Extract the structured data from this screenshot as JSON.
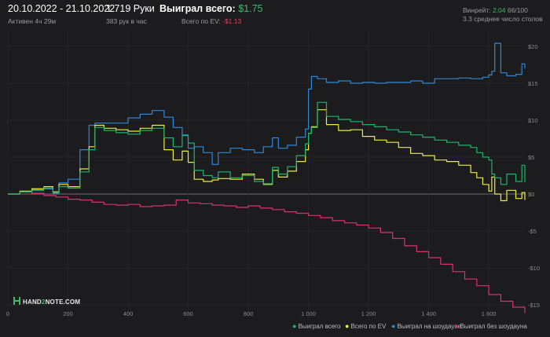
{
  "header": {
    "date_range": "20.10.2022 - 21.10.2022",
    "active": "Активен 4ч 29м",
    "hands": "1 719 Руки",
    "hands_per_hour": "383 рук в час",
    "won_total_label": "Выиграл всего:",
    "won_total_value": "$1.75",
    "ev_label": "Всего по EV:",
    "ev_value": "-$1.13",
    "winrate_label": "Винрейт:",
    "winrate_value": "2.04",
    "winrate_suffix": "66/100",
    "avg_table": "3.3 среднее число столов"
  },
  "logo": {
    "text_left": "HAND",
    "text_mid": "2",
    "text_right": "NOTE.COM"
  },
  "colors": {
    "won_total": "#1db46a",
    "ev": "#eded3a",
    "showdown": "#2f86d6",
    "non_showdown": "#d8336b",
    "background": "#1c1c1e",
    "grid": "#2c2c2e",
    "zero_line": "#8a8a8a"
  },
  "chart_data": {
    "type": "line",
    "xlim": [
      0,
      1720
    ],
    "ylim": [
      -17,
      22
    ],
    "x_ticks": [
      0,
      200,
      400,
      600,
      800,
      1000,
      1200,
      1400,
      1600
    ],
    "x_tick_labels": [
      "0",
      "200",
      "400",
      "600",
      "800",
      "1 000",
      "1 200",
      "1 400",
      "1 600"
    ],
    "y_ticks": [
      20,
      15,
      10,
      5,
      0,
      -5,
      -10,
      -15
    ],
    "y_tick_labels": [
      "$20",
      "$15",
      "$10",
      "$5",
      "$0",
      "-$5",
      "-$10",
      "-$15"
    ],
    "legend_position": "bottom-right",
    "series": [
      {
        "name": "Выиграл всего",
        "color_key": "won_total",
        "x": [
          0,
          40,
          80,
          120,
          150,
          170,
          200,
          240,
          270,
          290,
          320,
          360,
          400,
          440,
          480,
          520,
          550,
          580,
          600,
          620,
          650,
          680,
          700,
          740,
          780,
          820,
          850,
          880,
          900,
          930,
          960,
          990,
          1000,
          1010,
          1030,
          1060,
          1100,
          1140,
          1180,
          1220,
          1260,
          1300,
          1340,
          1380,
          1420,
          1460,
          1500,
          1540,
          1560,
          1580,
          1600,
          1610,
          1620,
          1640,
          1660,
          1690,
          1710,
          1720
        ],
        "y": [
          0,
          0.3,
          0.5,
          0.8,
          0.2,
          1.0,
          0.8,
          3.0,
          6.0,
          9.0,
          8.6,
          8.3,
          8.1,
          8.6,
          8.9,
          7.6,
          6.4,
          7.9,
          6.9,
          3.2,
          2.5,
          2.2,
          3.0,
          2.2,
          2.5,
          1.7,
          1.4,
          3.6,
          2.7,
          3.7,
          5.2,
          6.8,
          8.2,
          9.0,
          12.4,
          10.5,
          10.1,
          9.8,
          9.4,
          9.1,
          8.7,
          8.4,
          8.0,
          7.7,
          7.3,
          7.0,
          6.6,
          6.3,
          5.6,
          5.0,
          4.6,
          2.7,
          2.2,
          1.3,
          2.7,
          1.7,
          3.9,
          1.6
        ]
      },
      {
        "name": "Всего по EV",
        "color_key": "ev",
        "x": [
          0,
          40,
          80,
          120,
          150,
          170,
          200,
          240,
          270,
          290,
          320,
          360,
          400,
          440,
          480,
          520,
          550,
          580,
          600,
          620,
          650,
          680,
          700,
          740,
          780,
          820,
          850,
          880,
          900,
          930,
          960,
          990,
          1000,
          1010,
          1030,
          1060,
          1100,
          1140,
          1180,
          1220,
          1260,
          1300,
          1340,
          1380,
          1420,
          1460,
          1500,
          1540,
          1560,
          1580,
          1600,
          1610,
          1620,
          1640,
          1660,
          1690,
          1710,
          1720
        ],
        "y": [
          0,
          0.4,
          0.7,
          1.0,
          0.3,
          1.3,
          1.0,
          3.4,
          6.4,
          9.3,
          8.9,
          8.7,
          8.5,
          8.9,
          9.3,
          6.0,
          4.6,
          5.8,
          4.3,
          2.0,
          1.7,
          1.9,
          2.1,
          2.0,
          2.7,
          2.0,
          1.3,
          3.2,
          2.3,
          3.1,
          4.4,
          6.0,
          8.2,
          9.1,
          11.4,
          9.4,
          8.6,
          8.7,
          7.8,
          7.3,
          7.0,
          6.3,
          5.5,
          5.2,
          4.6,
          4.4,
          3.9,
          2.9,
          2.2,
          1.3,
          0.4,
          2.3,
          0.0,
          -0.9,
          0.5,
          -0.6,
          0.2,
          -0.8
        ]
      },
      {
        "name": "Выиграл на шоудауне",
        "color_key": "showdown",
        "x": [
          0,
          40,
          80,
          120,
          150,
          170,
          200,
          240,
          270,
          290,
          320,
          360,
          400,
          440,
          480,
          520,
          550,
          580,
          600,
          620,
          650,
          680,
          700,
          740,
          780,
          820,
          850,
          880,
          900,
          930,
          960,
          990,
          1000,
          1010,
          1030,
          1060,
          1100,
          1140,
          1180,
          1220,
          1260,
          1300,
          1340,
          1380,
          1420,
          1460,
          1500,
          1540,
          1560,
          1580,
          1600,
          1610,
          1620,
          1640,
          1660,
          1690,
          1710,
          1720
        ],
        "y": [
          0,
          0.3,
          0.6,
          0.7,
          0.1,
          1.5,
          2.0,
          6.0,
          9.3,
          9.6,
          9.6,
          9.6,
          10.3,
          10.8,
          11.3,
          10.4,
          9.0,
          8.0,
          6.2,
          6.4,
          5.6,
          4.0,
          5.6,
          6.2,
          6.0,
          5.6,
          6.4,
          7.6,
          6.2,
          6.6,
          7.7,
          8.8,
          14.2,
          15.9,
          15.6,
          15.1,
          15.3,
          15.0,
          15.1,
          15.0,
          15.1,
          15.1,
          15.3,
          15.0,
          15.6,
          15.6,
          15.7,
          15.6,
          15.6,
          15.8,
          16.1,
          16.6,
          20.4,
          16.4,
          16.0,
          16.2,
          17.6,
          17.0
        ]
      },
      {
        "name": "Выиграл без шоудауна",
        "color_key": "non_showdown",
        "x": [
          0,
          40,
          80,
          120,
          160,
          200,
          240,
          280,
          320,
          360,
          400,
          440,
          480,
          520,
          560,
          600,
          640,
          680,
          720,
          760,
          800,
          840,
          880,
          920,
          960,
          1000,
          1040,
          1080,
          1120,
          1160,
          1200,
          1240,
          1280,
          1320,
          1360,
          1400,
          1440,
          1480,
          1520,
          1560,
          1600,
          1640,
          1680,
          1720
        ],
        "y": [
          0,
          0.3,
          0.1,
          -0.2,
          -0.4,
          -0.7,
          -0.8,
          -1.1,
          -1.4,
          -1.5,
          -1.4,
          -1.7,
          -1.6,
          -1.5,
          -0.8,
          -1.2,
          -1.3,
          -1.5,
          -1.6,
          -1.8,
          -1.6,
          -1.9,
          -2.1,
          -2.4,
          -2.6,
          -2.9,
          -3.2,
          -3.6,
          -3.9,
          -4.2,
          -4.6,
          -5.2,
          -6.0,
          -7.0,
          -7.8,
          -8.6,
          -9.5,
          -10.5,
          -11.5,
          -12.4,
          -13.6,
          -14.5,
          -15.3,
          -16.1
        ]
      }
    ]
  }
}
